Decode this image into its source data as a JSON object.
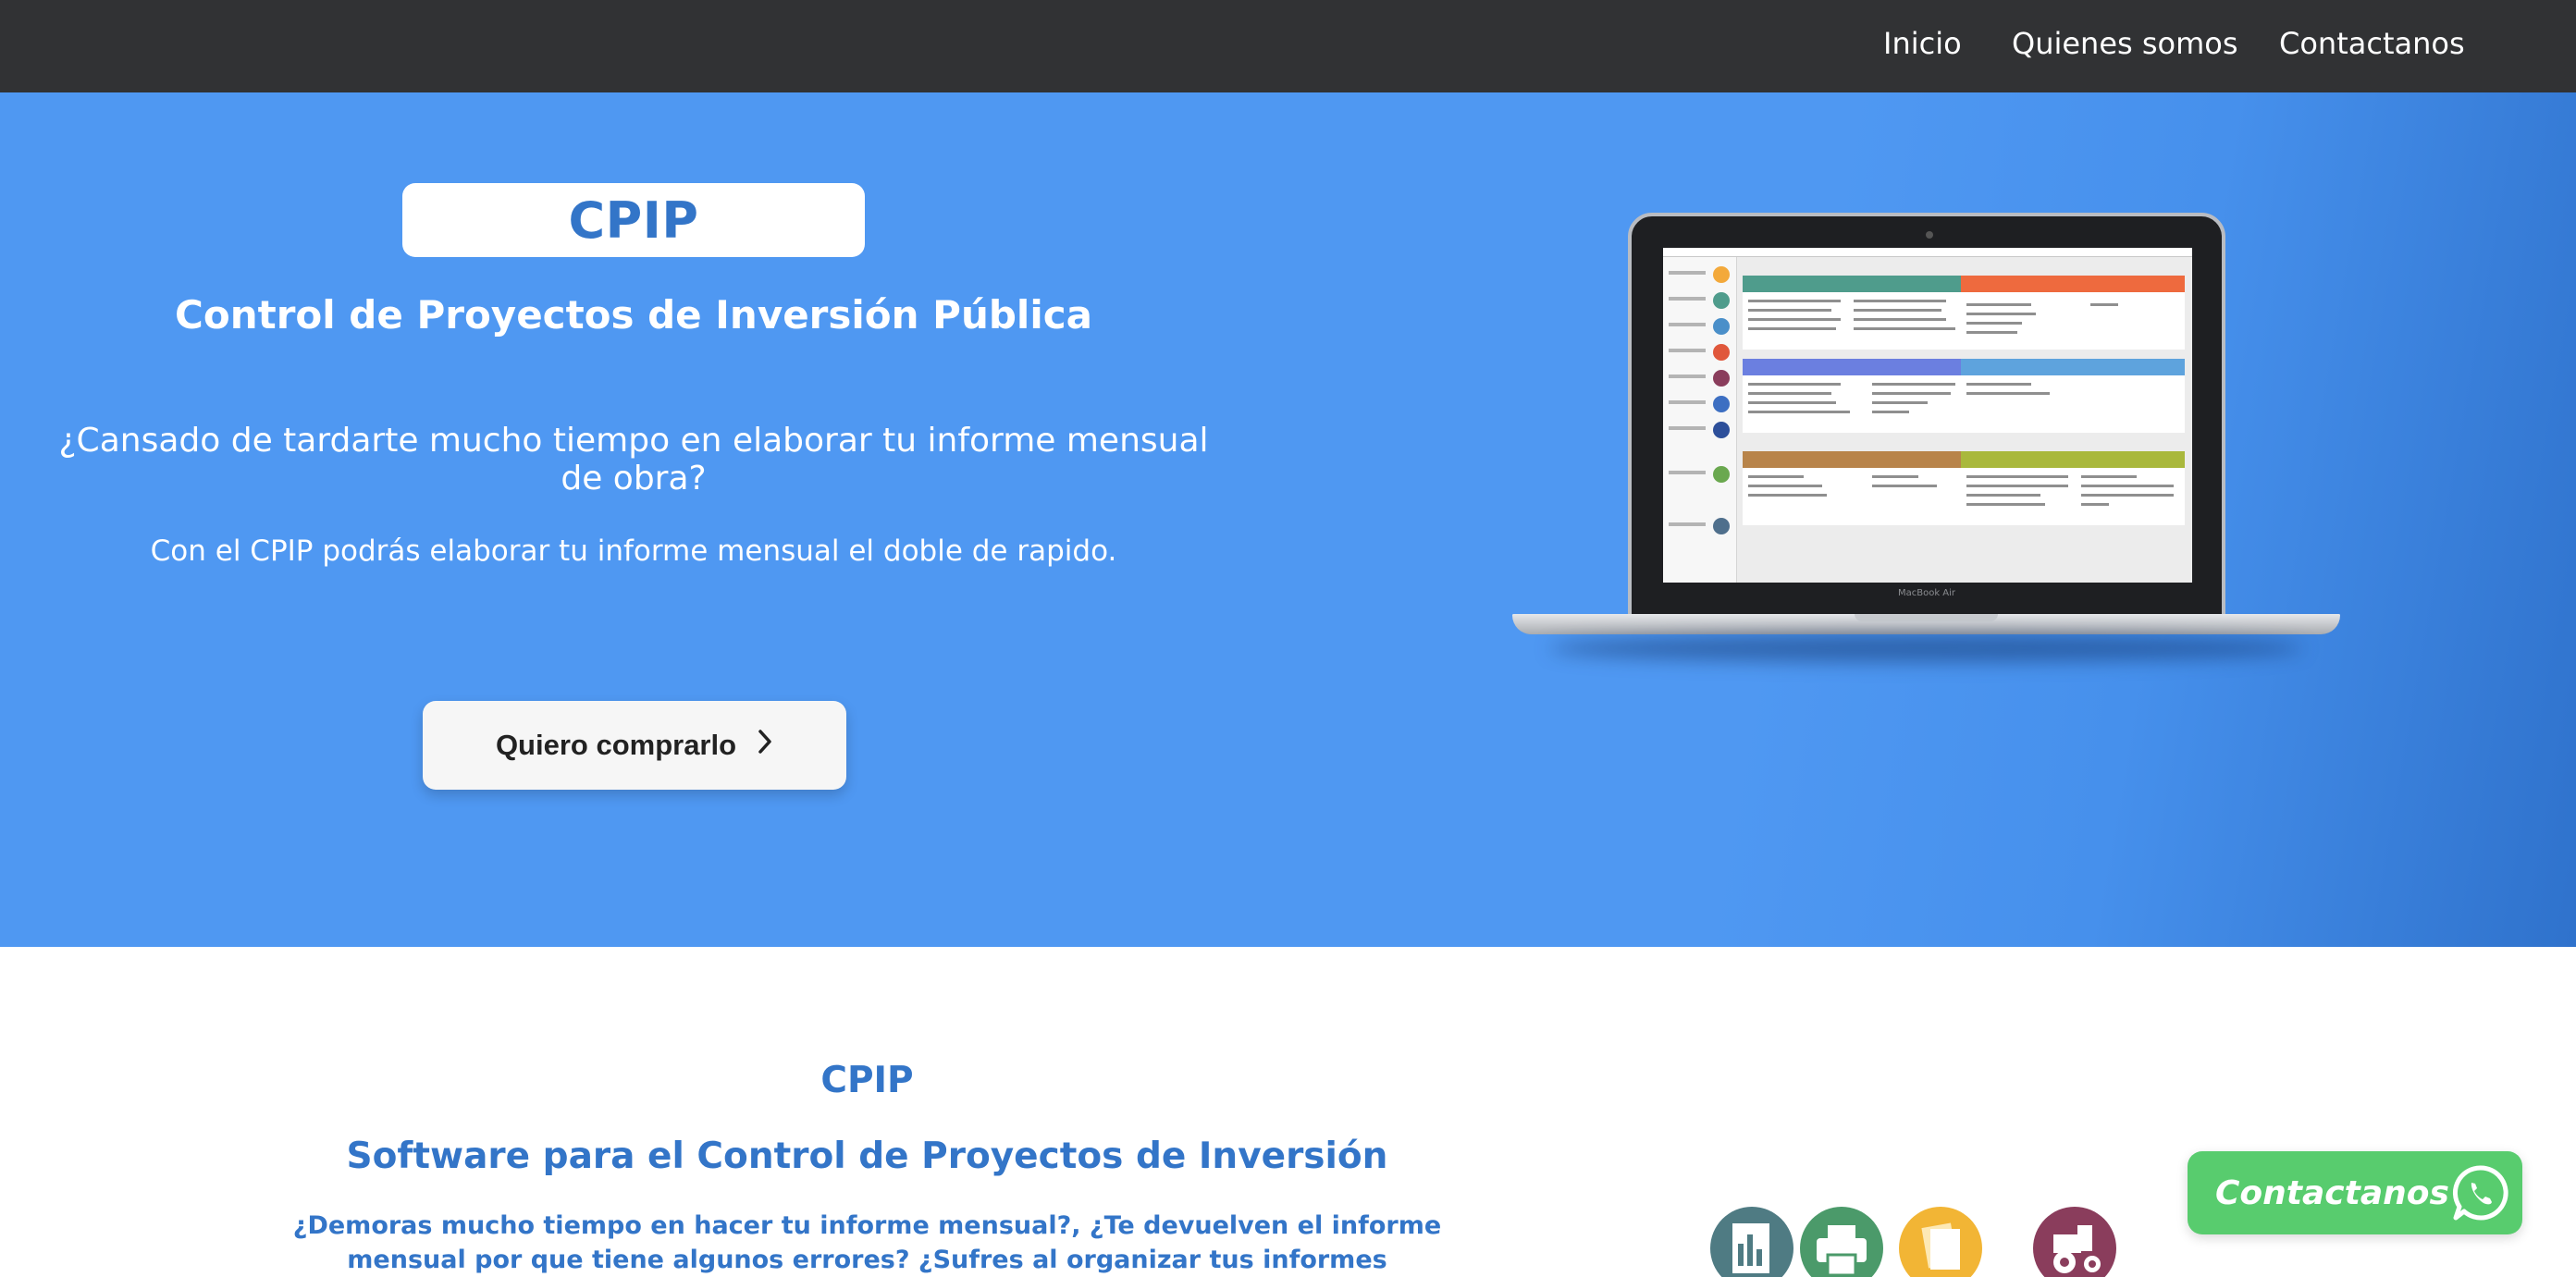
{
  "nav": {
    "items": [
      {
        "label": "Inicio"
      },
      {
        "label": "Quienes somos"
      },
      {
        "label": "Contactanos"
      }
    ]
  },
  "hero": {
    "brand": "CPIP",
    "title": "Control de Proyectos de Inversión Pública",
    "question": "¿Cansado de tardarte mucho tiempo en elaborar tu informe mensual de obra?",
    "subtitle": "Con el CPIP podrás elaborar tu informe mensual el doble de rapido.",
    "cta_label": "Quiero comprarlo",
    "laptop_brand": "MacBook Air"
  },
  "section2": {
    "brand": "CPIP",
    "title": "Software para el Control de Proyectos de Inversión",
    "body": "¿Demoras mucho tiempo en hacer tu informe mensual?, ¿Te devuelven el informe mensual por que tiene algunos errores? ¿Sufres al organizar tus informes mensuales para"
  },
  "features": {
    "icons": [
      "chart-document-icon",
      "printer-icon",
      "documents-icon",
      "tractor-icon"
    ]
  },
  "whatsapp": {
    "label": "Contactanos"
  },
  "colors": {
    "nav_bg": "#313234",
    "hero_bg": "#4f98f2",
    "brand_blue": "#3375c8",
    "whatsapp_green": "#58cc6e"
  }
}
